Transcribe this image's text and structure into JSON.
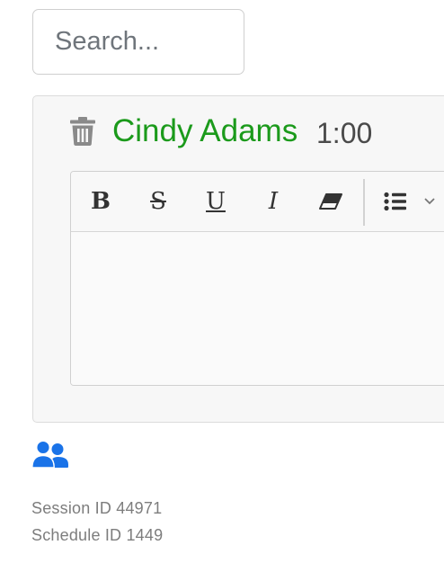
{
  "search": {
    "placeholder": "Search..."
  },
  "entry": {
    "name": "Cindy Adams",
    "duration": "1:00",
    "name_color": "#1b9a1b"
  },
  "toolbar": {
    "buttons": [
      {
        "label": "B",
        "icon": "bold-icon"
      },
      {
        "label": "S",
        "icon": "strikethrough-icon"
      },
      {
        "label": "U",
        "icon": "underline-icon"
      },
      {
        "label": "I",
        "icon": "italic-icon"
      },
      {
        "label": "",
        "icon": "eraser-icon"
      },
      {
        "label": "",
        "icon": "list-dropdown-icon"
      }
    ]
  },
  "editor": {
    "content": ""
  },
  "footer": {
    "session": "Session ID 44971",
    "schedule": "Schedule ID 1449",
    "people_icon_color": "#1a73e8"
  }
}
